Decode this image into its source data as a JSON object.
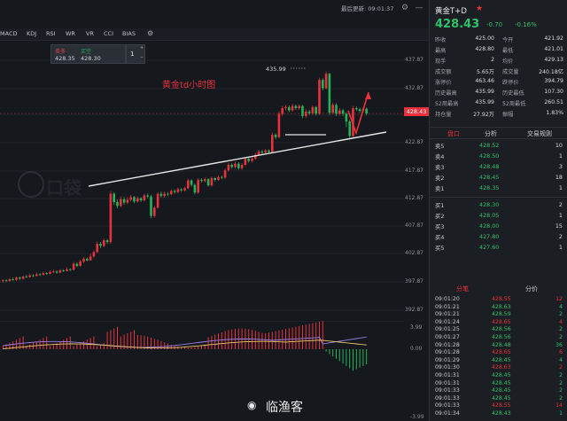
{
  "header": {
    "time_label": "最后更新: 09:01:37"
  },
  "indicators": {
    "tabs": [
      "MACD",
      "KDJ",
      "RSI",
      "WR",
      "VR",
      "CCI",
      "BIAS"
    ]
  },
  "order_box": {
    "sell_label": "卖多",
    "sell_value": "428.35",
    "buy_label": "买空",
    "buy_value": "428.30",
    "qty": "1"
  },
  "chart": {
    "annotation": "黄金td小时图",
    "peak_label": "435.99",
    "current_price": "428.43",
    "price_ticks": [
      "437.87",
      "432.87",
      "427.87",
      "422.87",
      "417.87",
      "412.87",
      "407.87",
      "402.87",
      "397.87",
      "392.87"
    ],
    "macd_ticks": [
      "3.99",
      "0.00",
      "-3.99"
    ],
    "colors": {
      "up": "#e8313c",
      "down": "#25b35a",
      "dif": "#9b7fe6",
      "dea": "#e8c56a"
    }
  },
  "watermark": {
    "text": "临渔客",
    "faint_text": "口袋"
  },
  "right_panel": {
    "title": "黄金T+D",
    "price": "428.43",
    "change": "-0.70",
    "percent": "-0.16%",
    "stats": [
      [
        "昨收",
        "425.00",
        "今开",
        "421.92"
      ],
      [
        "最高",
        "428.80",
        "最低",
        "421.01"
      ],
      [
        "现手",
        "2",
        "均价",
        "429.13"
      ],
      [
        "成交额",
        "5.65万",
        "成交量",
        "240.18亿"
      ],
      [
        "涨停价",
        "463.46",
        "跌停价",
        "394.79"
      ],
      [
        "历史最高",
        "435.99",
        "历史最低",
        "107.30"
      ],
      [
        "52周最高",
        "435.99",
        "52周最低",
        "260.51"
      ],
      [
        "持仓量",
        "27.92万",
        "振幅",
        "1.83%"
      ]
    ],
    "tabs": [
      "盘口",
      "分析",
      "交易规则"
    ],
    "asks": [
      [
        "卖5",
        "428.52",
        "10"
      ],
      [
        "卖4",
        "428.50",
        "1"
      ],
      [
        "卖3",
        "428.48",
        "3"
      ],
      [
        "卖2",
        "428.45",
        "18"
      ],
      [
        "卖1",
        "428.35",
        "1"
      ]
    ],
    "bids": [
      [
        "买1",
        "428.30",
        "2"
      ],
      [
        "买2",
        "428.05",
        "1"
      ],
      [
        "买3",
        "428.00",
        "15"
      ],
      [
        "买4",
        "427.80",
        "2"
      ],
      [
        "买5",
        "427.60",
        "1"
      ]
    ],
    "tabs2": [
      "分笔",
      "分价"
    ],
    "trades": [
      [
        "09:01:20",
        "428.55",
        "12",
        "r"
      ],
      [
        "09:01:21",
        "428.63",
        "4",
        "g"
      ],
      [
        "09:01:21",
        "428.59",
        "2",
        "g"
      ],
      [
        "09:01:24",
        "428.65",
        "4",
        "r"
      ],
      [
        "09:01:25",
        "428.56",
        "2",
        "g"
      ],
      [
        "09:01:27",
        "428.56",
        "2",
        "g"
      ],
      [
        "09:01:28",
        "428.48",
        "36",
        "g"
      ],
      [
        "09:01:28",
        "428.65",
        "6",
        "r"
      ],
      [
        "09:01:29",
        "428.45",
        "4",
        "g"
      ],
      [
        "09:01:30",
        "428.63",
        "2",
        "r"
      ],
      [
        "09:01:31",
        "428.45",
        "2",
        "g"
      ],
      [
        "09:01:31",
        "428.45",
        "2",
        "g"
      ],
      [
        "09:01:33",
        "428.45",
        "2",
        "g"
      ],
      [
        "09:01:33",
        "428.45",
        "2",
        "g"
      ],
      [
        "09:01:33",
        "428.55",
        "14",
        "r"
      ],
      [
        "09:01:34",
        "428.43",
        "1",
        "g"
      ]
    ]
  }
}
